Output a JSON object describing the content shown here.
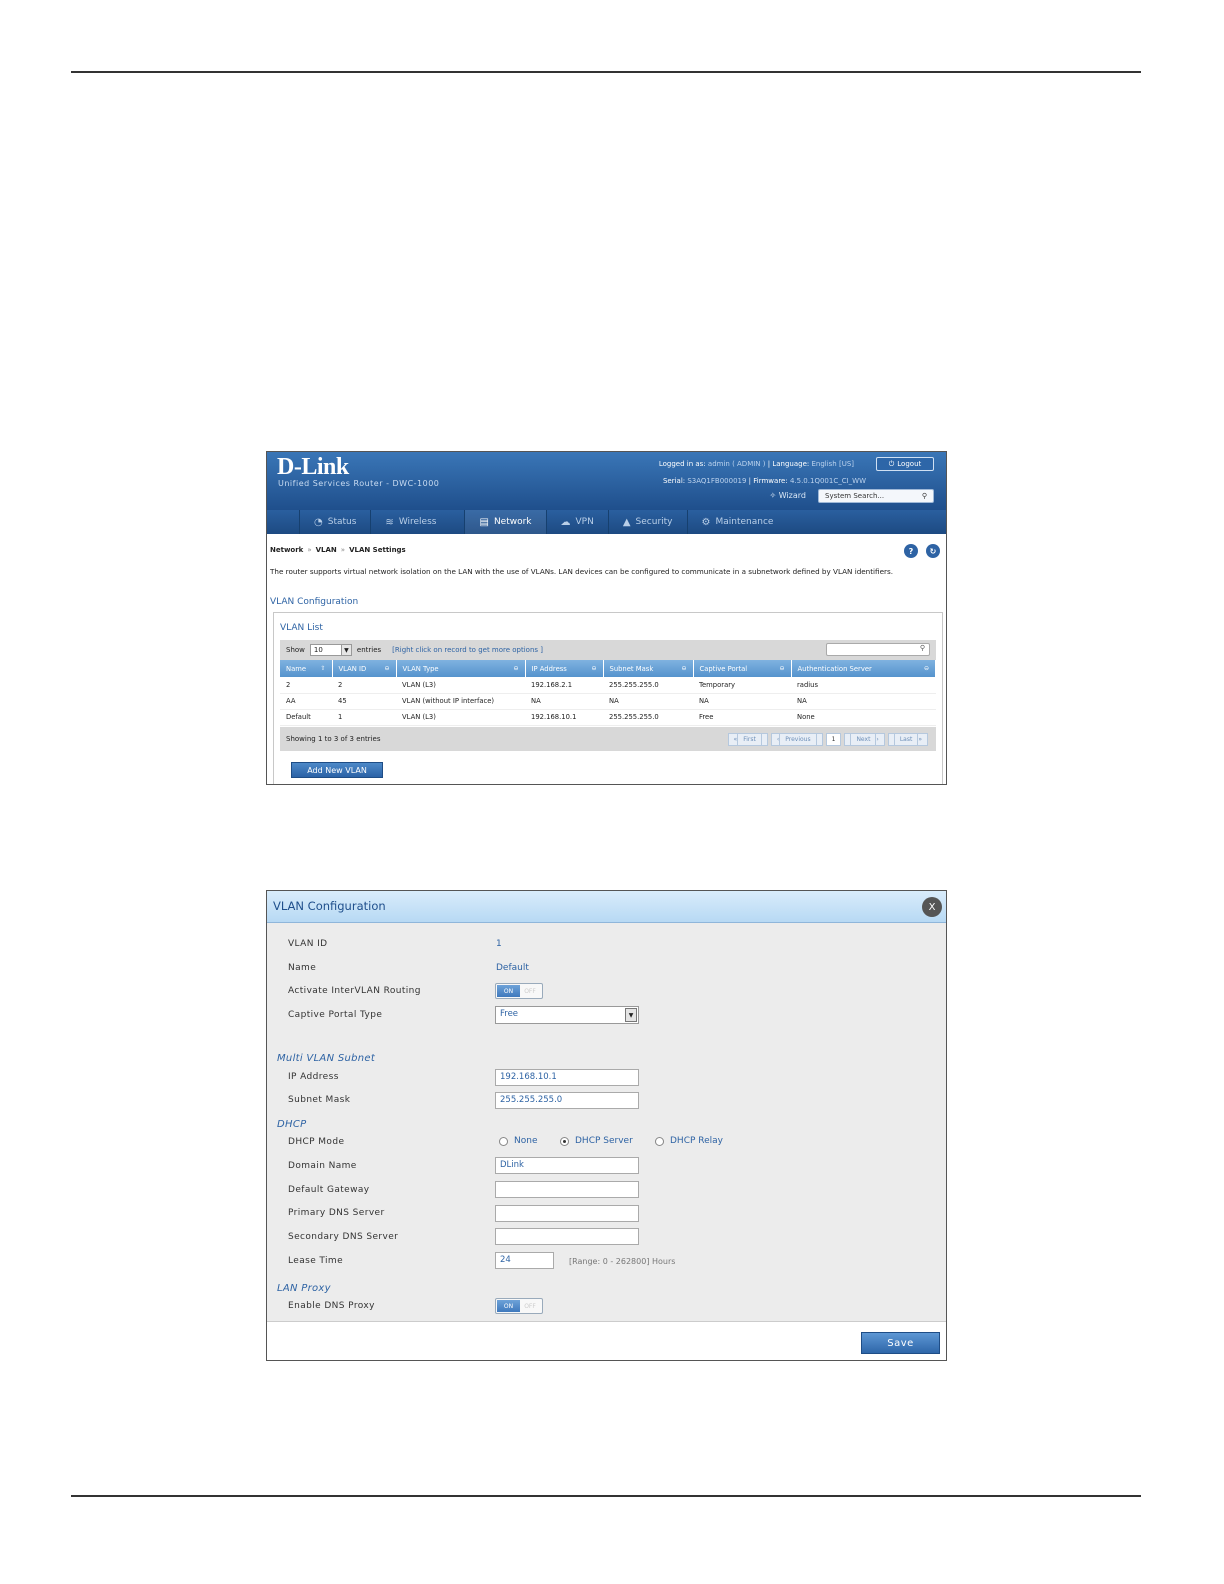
{
  "shot1": {
    "brand": "D-Link",
    "subtitle": "Unified Services Router - DWC-1000",
    "logged_in_label": "Logged in as:",
    "logged_in_user": "admin ( ADMIN )",
    "language_label": "Language:",
    "language_value": "English [US]",
    "logout_label": "Logout",
    "serial_label": "Serial:",
    "serial_value": "S3AQ1FB000019",
    "firmware_label": "Firmware:",
    "firmware_value": "4.5.0.1Q001C_CI_WW",
    "wizard_label": "Wizard",
    "system_search_placeholder": "System Search...",
    "nav": [
      {
        "label": "Status",
        "icon": "gauge-icon"
      },
      {
        "label": "Wireless",
        "icon": "wifi-icon"
      },
      {
        "label": "Network",
        "icon": "network-icon"
      },
      {
        "label": "VPN",
        "icon": "cloud-icon"
      },
      {
        "label": "Security",
        "icon": "lock-icon"
      },
      {
        "label": "Maintenance",
        "icon": "gears-icon"
      }
    ],
    "breadcrumb": [
      "Network",
      "VLAN",
      "VLAN Settings"
    ],
    "breadcrumb_sep": "»",
    "description": "The router supports virtual network isolation on the LAN with the use of VLANs. LAN devices can be configured to communicate in a subnetwork defined by VLAN identifiers.",
    "section_title": "VLAN Configuration",
    "list_title": "VLAN List",
    "show_label": "Show",
    "show_value": "10",
    "entries_label": "entries",
    "hint": "[Right click on record to get more options ]",
    "columns": [
      "Name",
      "VLAN ID",
      "VLAN Type",
      "IP Address",
      "Subnet Mask",
      "Captive Portal",
      "Authentication Server"
    ],
    "rows": [
      [
        "2",
        "2",
        "VLAN (L3)",
        "192.168.2.1",
        "255.255.255.0",
        "Temporary",
        "radius"
      ],
      [
        "AA",
        "45",
        "VLAN (without IP interface)",
        "NA",
        "NA",
        "NA",
        "NA"
      ],
      [
        "Default",
        "1",
        "VLAN (L3)",
        "192.168.10.1",
        "255.255.255.0",
        "Free",
        "None"
      ]
    ],
    "showing_text": "Showing 1 to 3 of 3 entries",
    "pager": {
      "first": "First",
      "previous": "Previous",
      "current": "1",
      "next": "Next",
      "last": "Last"
    },
    "add_button": "Add New VLAN"
  },
  "shot2": {
    "title": "VLAN Configuration",
    "close_label": "X",
    "vlan_id_label": "VLAN ID",
    "vlan_id_value": "1",
    "name_label": "Name",
    "name_value": "Default",
    "intervlan_label": "Activate InterVLAN Routing",
    "toggle_on": "ON",
    "toggle_off": "OFF",
    "captive_label": "Captive Portal Type",
    "captive_value": "Free",
    "multi_vlan_title": "Multi VLAN Subnet",
    "ip_label": "IP Address",
    "ip_value": "192.168.10.1",
    "mask_label": "Subnet Mask",
    "mask_value": "255.255.255.0",
    "dhcp_title": "DHCP",
    "dhcp_mode_label": "DHCP Mode",
    "dhcp_options": [
      "None",
      "DHCP Server",
      "DHCP Relay"
    ],
    "dhcp_selected": "DHCP Server",
    "domain_label": "Domain Name",
    "domain_value": "DLink",
    "gateway_label": "Default Gateway",
    "gateway_value": "",
    "dns1_label": "Primary DNS Server",
    "dns1_value": "",
    "dns2_label": "Secondary DNS Server",
    "dns2_value": "",
    "lease_label": "Lease Time",
    "lease_value": "24",
    "lease_range": "[Range: 0 - 262800] Hours",
    "lan_proxy_title": "LAN Proxy",
    "dns_proxy_label": "Enable DNS Proxy",
    "save_label": "Save"
  }
}
